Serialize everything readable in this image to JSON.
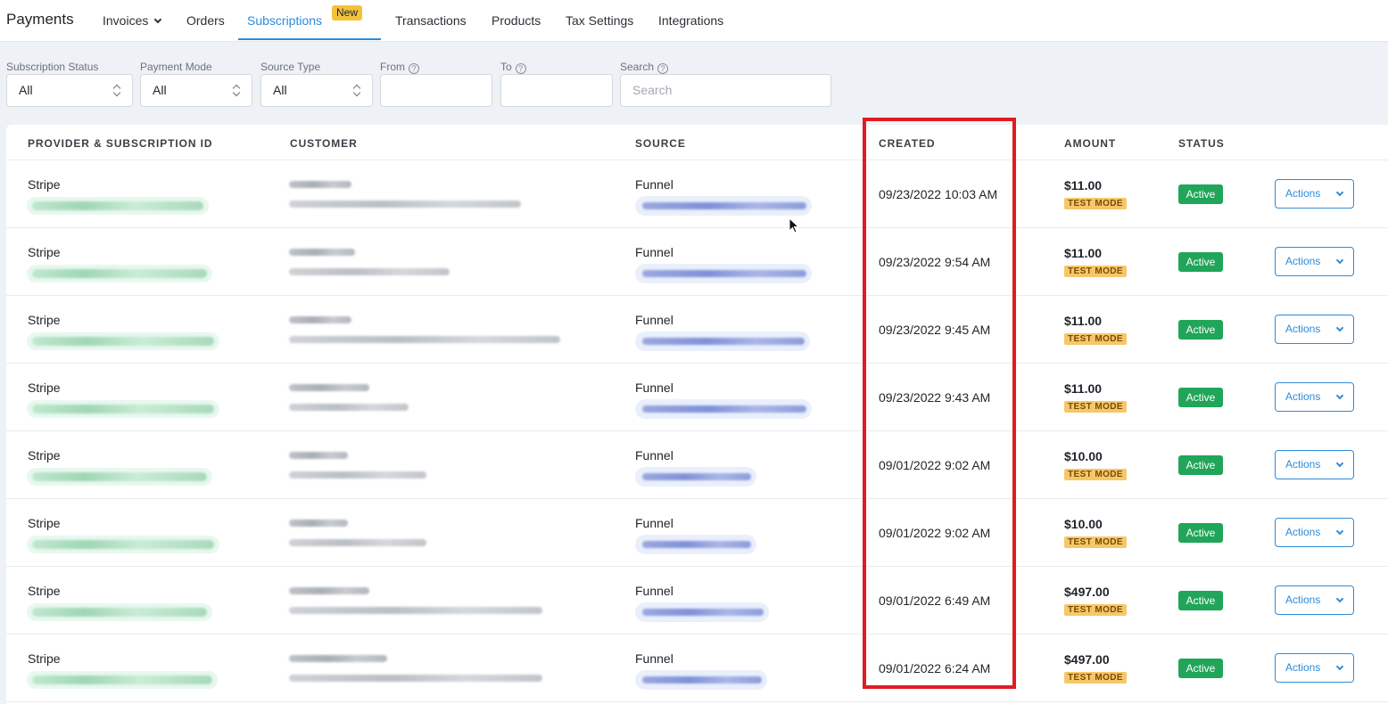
{
  "app": {
    "title": "Payments"
  },
  "nav": {
    "items": [
      {
        "label": "Invoices"
      },
      {
        "label": "Orders"
      },
      {
        "label": "Subscriptions",
        "badge": "New"
      },
      {
        "label": "Transactions"
      },
      {
        "label": "Products"
      },
      {
        "label": "Tax Settings"
      },
      {
        "label": "Integrations"
      }
    ],
    "active": "Subscriptions",
    "accent_color": "#2e8bd8",
    "badge_color": "#f3c13a"
  },
  "filters": {
    "subscription_status": {
      "label": "Subscription Status",
      "value": "All"
    },
    "payment_mode": {
      "label": "Payment Mode",
      "value": "All"
    },
    "source_type": {
      "label": "Source Type",
      "value": "All"
    },
    "from": {
      "label": "From",
      "value": ""
    },
    "to": {
      "label": "To",
      "value": ""
    },
    "search": {
      "label": "Search",
      "placeholder": "Search",
      "value": ""
    }
  },
  "table": {
    "headers": {
      "provider": "PROVIDER & SUBSCRIPTION ID",
      "customer": "CUSTOMER",
      "source": "SOURCE",
      "created": "CREATED",
      "amount": "AMOUNT",
      "status": "STATUS"
    },
    "rows": [
      {
        "provider": "Stripe",
        "source": "Funnel",
        "created": "09/23/2022 10:03 AM",
        "amount": "$11.00",
        "mode": "TEST MODE",
        "status": "Active",
        "action": "Actions"
      },
      {
        "provider": "Stripe",
        "source": "Funnel",
        "created": "09/23/2022 9:54 AM",
        "amount": "$11.00",
        "mode": "TEST MODE",
        "status": "Active",
        "action": "Actions"
      },
      {
        "provider": "Stripe",
        "source": "Funnel",
        "created": "09/23/2022 9:45 AM",
        "amount": "$11.00",
        "mode": "TEST MODE",
        "status": "Active",
        "action": "Actions"
      },
      {
        "provider": "Stripe",
        "source": "Funnel",
        "created": "09/23/2022 9:43 AM",
        "amount": "$11.00",
        "mode": "TEST MODE",
        "status": "Active",
        "action": "Actions"
      },
      {
        "provider": "Stripe",
        "source": "Funnel",
        "created": "09/01/2022 9:02 AM",
        "amount": "$10.00",
        "mode": "TEST MODE",
        "status": "Active",
        "action": "Actions"
      },
      {
        "provider": "Stripe",
        "source": "Funnel",
        "created": "09/01/2022 9:02 AM",
        "amount": "$10.00",
        "mode": "TEST MODE",
        "status": "Active",
        "action": "Actions"
      },
      {
        "provider": "Stripe",
        "source": "Funnel",
        "created": "09/01/2022 6:49 AM",
        "amount": "$497.00",
        "mode": "TEST MODE",
        "status": "Active",
        "action": "Actions"
      },
      {
        "provider": "Stripe",
        "source": "Funnel",
        "created": "09/01/2022 6:24 AM",
        "amount": "$497.00",
        "mode": "TEST MODE",
        "status": "Active",
        "action": "Actions"
      }
    ]
  },
  "colors": {
    "status_active": "#20a559",
    "test_mode": "#f6c76a",
    "highlight": "#e01b24"
  }
}
